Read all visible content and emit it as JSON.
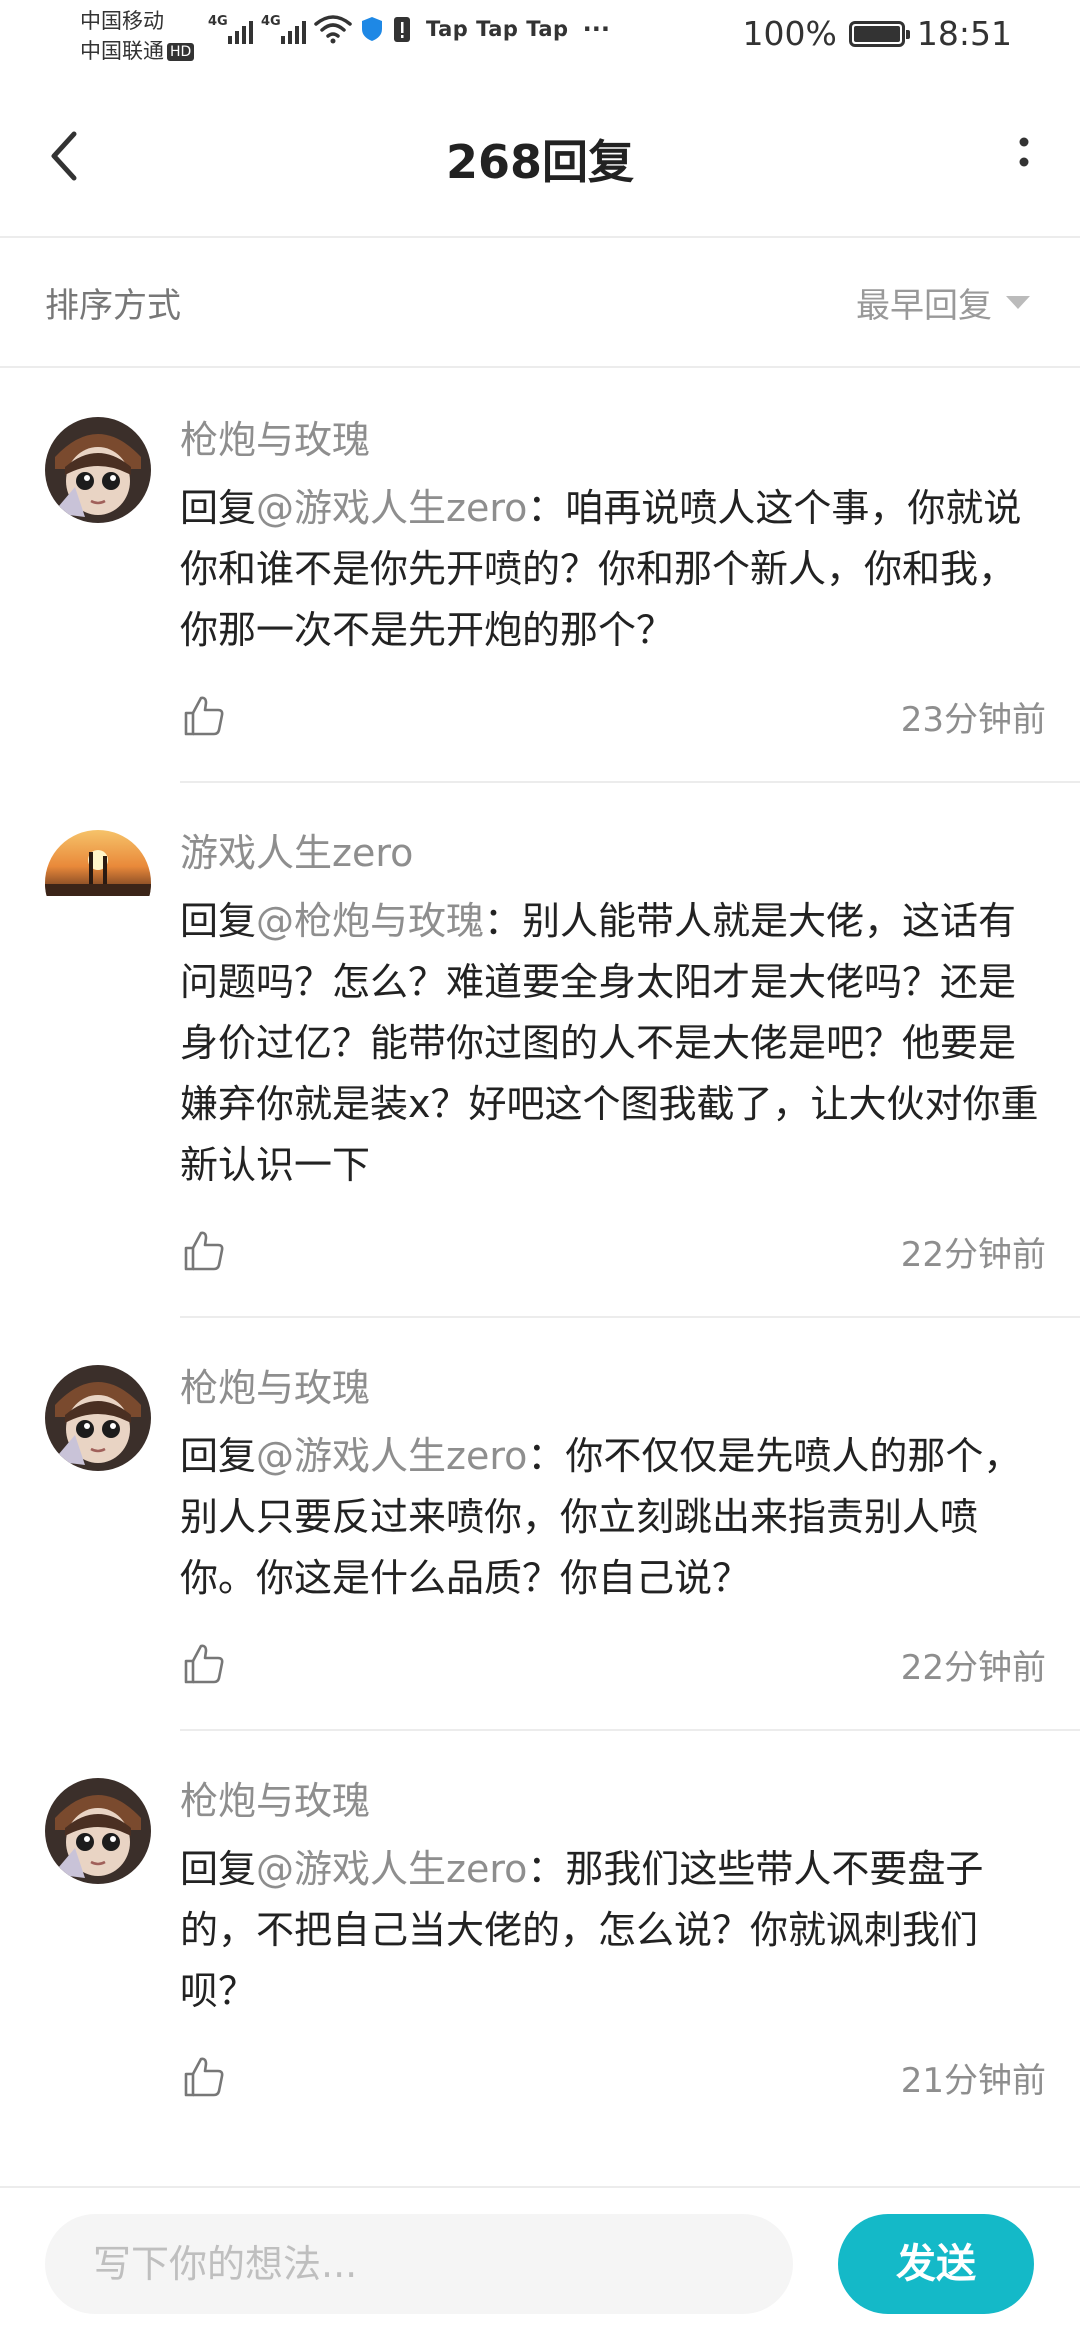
{
  "status_bar": {
    "carrier_top": "中国移动",
    "carrier_bottom": "中国联通",
    "hd_badge": "HD",
    "network_1": "4G",
    "network_2": "4G",
    "notification_app": "Tap Tap Tap",
    "more_dots": "···",
    "battery_percent": "100%",
    "battery_level": 1.0,
    "time": "18:51"
  },
  "header": {
    "title": "268回复",
    "back_icon": "chevron-left-icon",
    "more_icon": "vertical-dots-icon"
  },
  "sort": {
    "label": "排序方式",
    "selected": "最早回复",
    "dropdown_icon": "triangle-down-icon"
  },
  "comments": [
    {
      "author": "枪炮与玫瑰",
      "avatar_icon": "avatar-doll-icon",
      "reply_prefix": "回复",
      "mention": "@游戏人生zero",
      "text": "：咱再说喷人这个事，你就说你和谁不是你先开喷的？你和那个新人，你和我，你那一次不是先开炮的那个？",
      "time": "23分钟前"
    },
    {
      "author": "游戏人生zero",
      "avatar_icon": "avatar-sunset-icon",
      "reply_prefix": "回复",
      "mention": "@枪炮与玫瑰",
      "text": "：别人能带人就是大佬，这话有问题吗？怎么？难道要全身太阳才是大佬吗？还是身价过亿？能带你过图的人不是大佬是吧？他要是嫌弃你就是装x？好吧这个图我截了，让大伙对你重新认识一下",
      "time": "22分钟前"
    },
    {
      "author": "枪炮与玫瑰",
      "avatar_icon": "avatar-doll-icon",
      "reply_prefix": "回复",
      "mention": "@游戏人生zero",
      "text": "：你不仅仅是先喷人的那个，别人只要反过来喷你，你立刻跳出来指责别人喷你。你这是什么品质？你自己说？",
      "time": "22分钟前"
    },
    {
      "author": "枪炮与玫瑰",
      "avatar_icon": "avatar-doll-icon",
      "reply_prefix": "回复",
      "mention": "@游戏人生zero",
      "text": "：那我们这些带人不要盘子的，不把自己当大佬的，怎么说？你就讽刺我们呗？",
      "time": "21分钟前"
    }
  ],
  "composer": {
    "placeholder": "写下你的想法...",
    "send_label": "发送",
    "accent_color": "#14b9c8"
  }
}
